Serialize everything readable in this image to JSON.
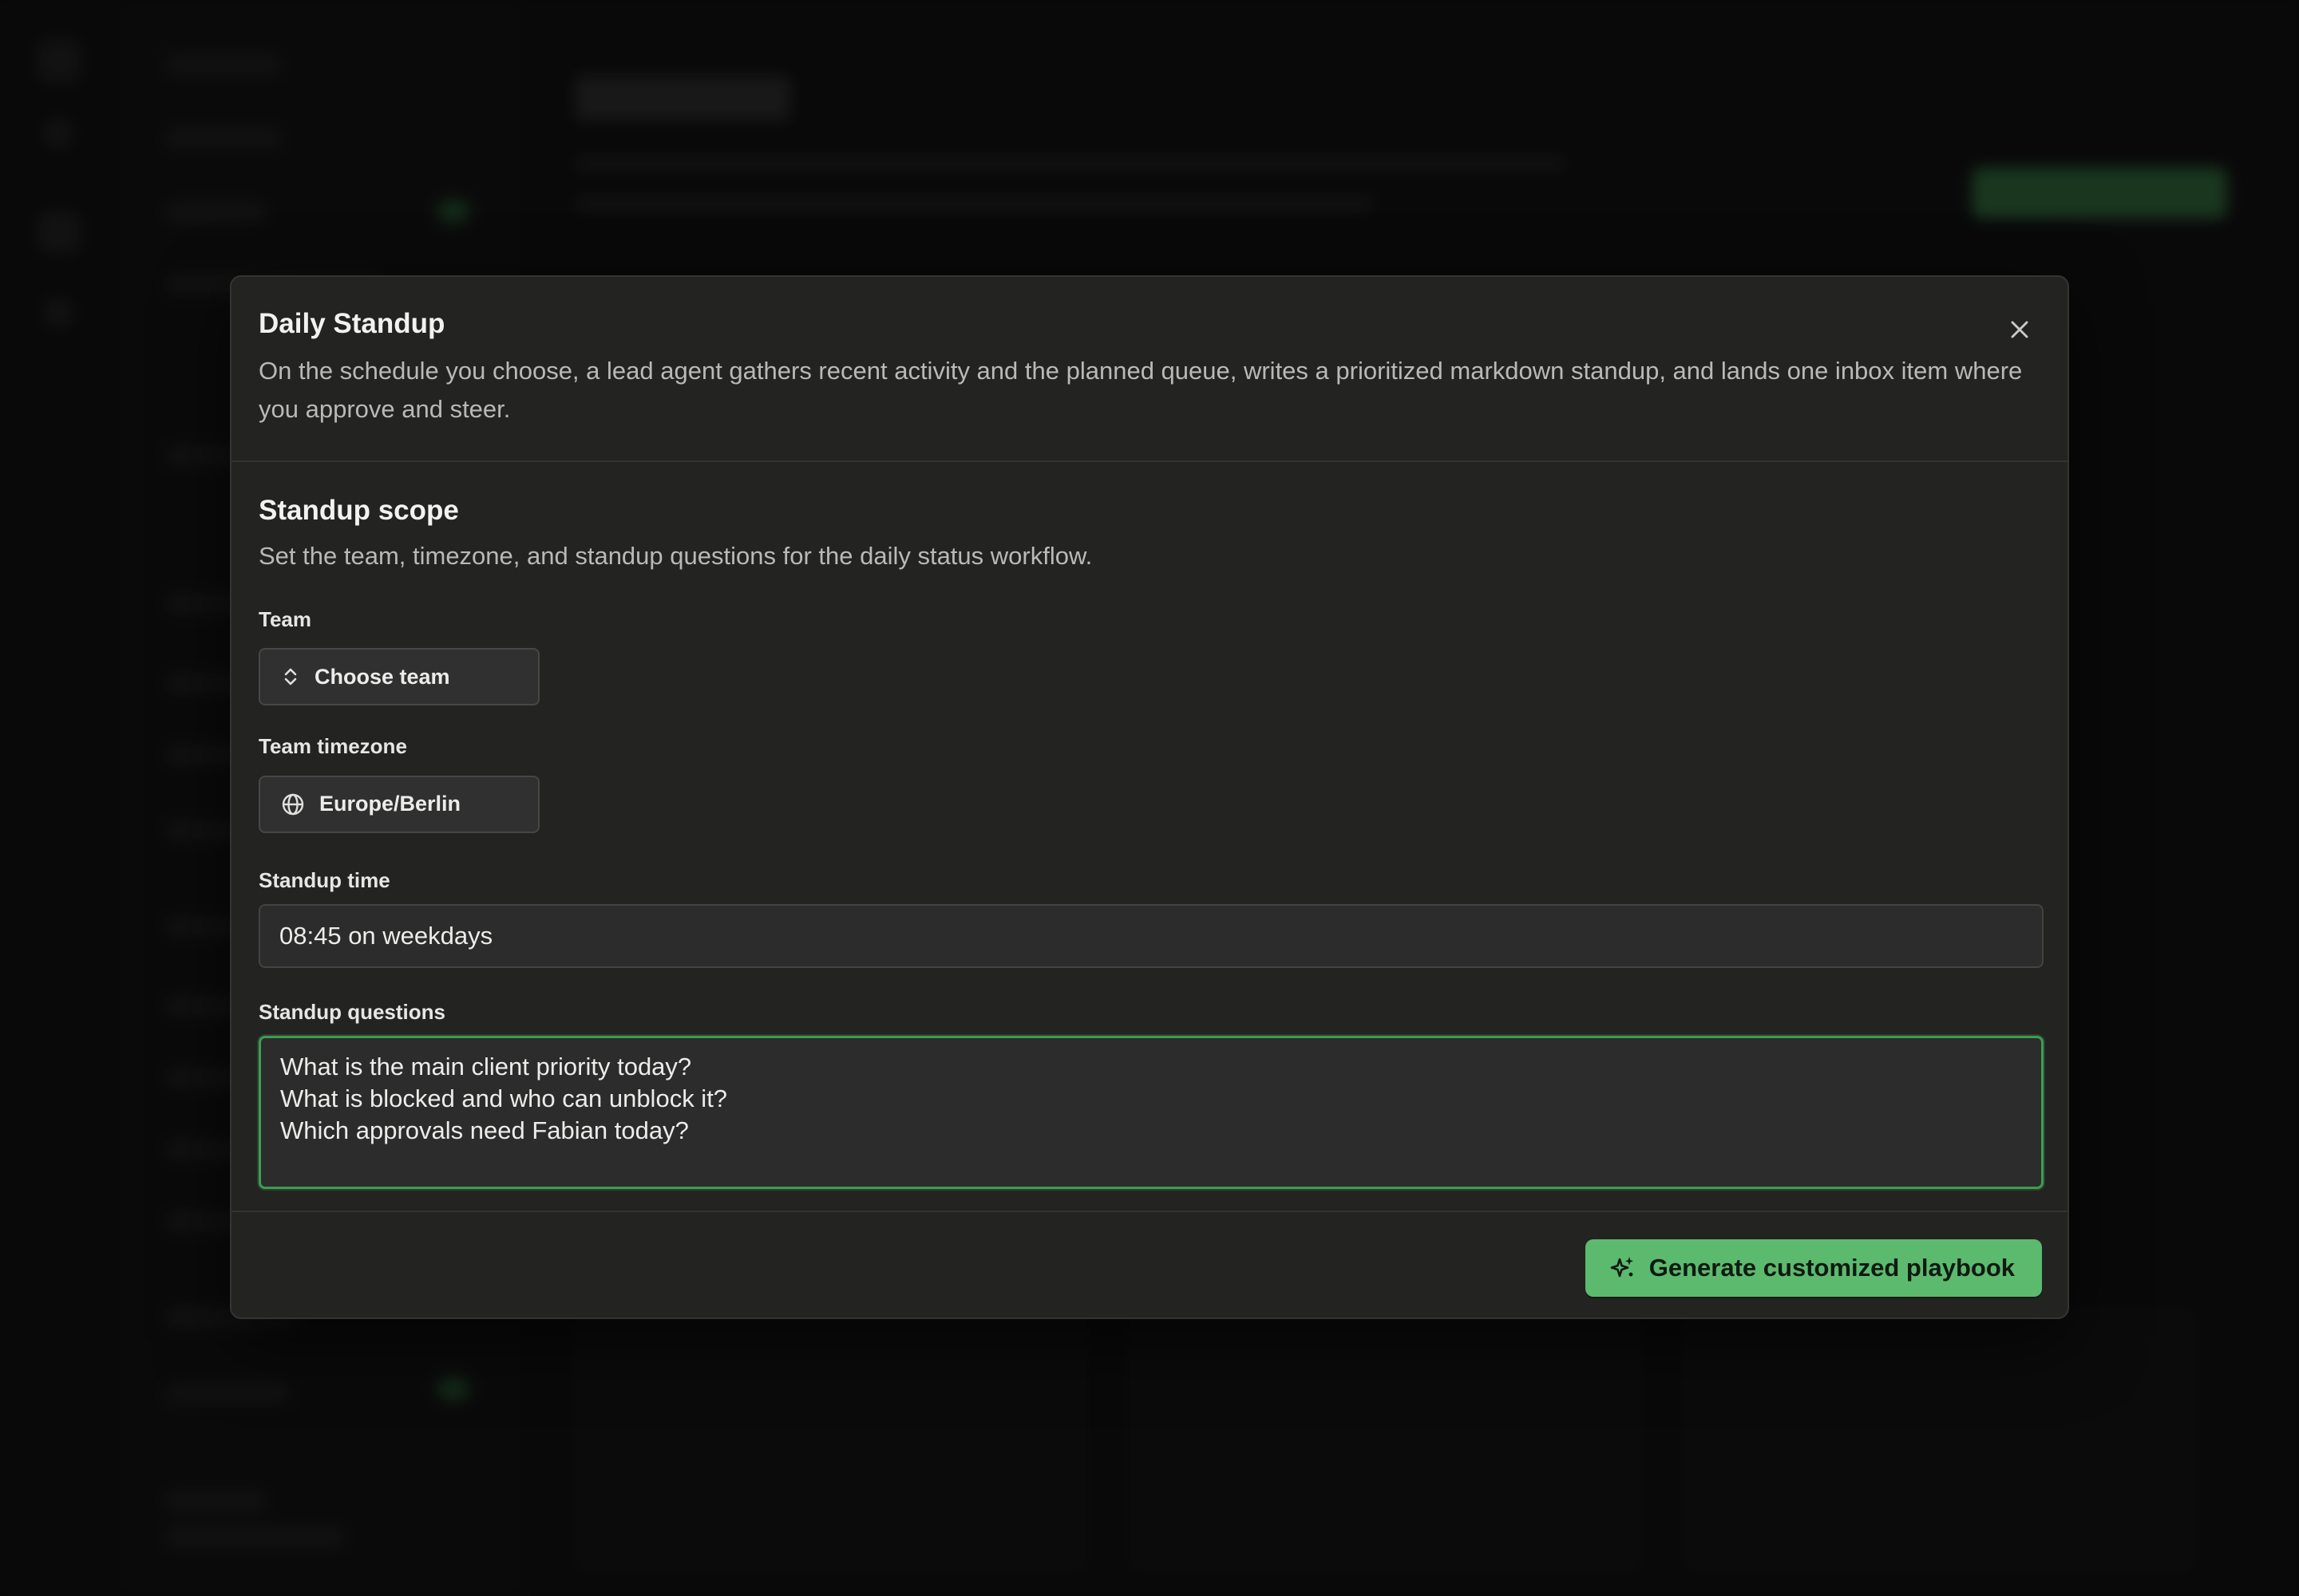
{
  "dialog": {
    "title": "Daily Standup",
    "description": "On the schedule you choose, a lead agent gathers recent activity and the planned queue, writes a prioritized markdown standup, and lands one inbox item where you approve and steer.",
    "close_icon": "close-icon"
  },
  "section": {
    "title": "Standup scope",
    "description": "Set the team, timezone, and standup questions for the daily status workflow."
  },
  "fields": {
    "team": {
      "label": "Team",
      "value": "Choose team",
      "icon": "chevron-up-down-icon"
    },
    "timezone": {
      "label": "Team timezone",
      "value": "Europe/Berlin",
      "icon": "globe-icon"
    },
    "standup_time": {
      "label": "Standup time",
      "value": "08:45 on weekdays"
    },
    "questions": {
      "label": "Standup questions",
      "lines": [
        "What is the main client priority today?",
        "What is blocked and who can unblock it?",
        "Which approvals need Fabian today?"
      ]
    }
  },
  "footer": {
    "generate_label": "Generate customized playbook",
    "generate_icon": "sparkles-icon"
  },
  "colors": {
    "accent": "#5cba6e",
    "focus_border": "#3f9c52",
    "modal_bg": "#232322",
    "page_bg": "#0d0d0d"
  }
}
